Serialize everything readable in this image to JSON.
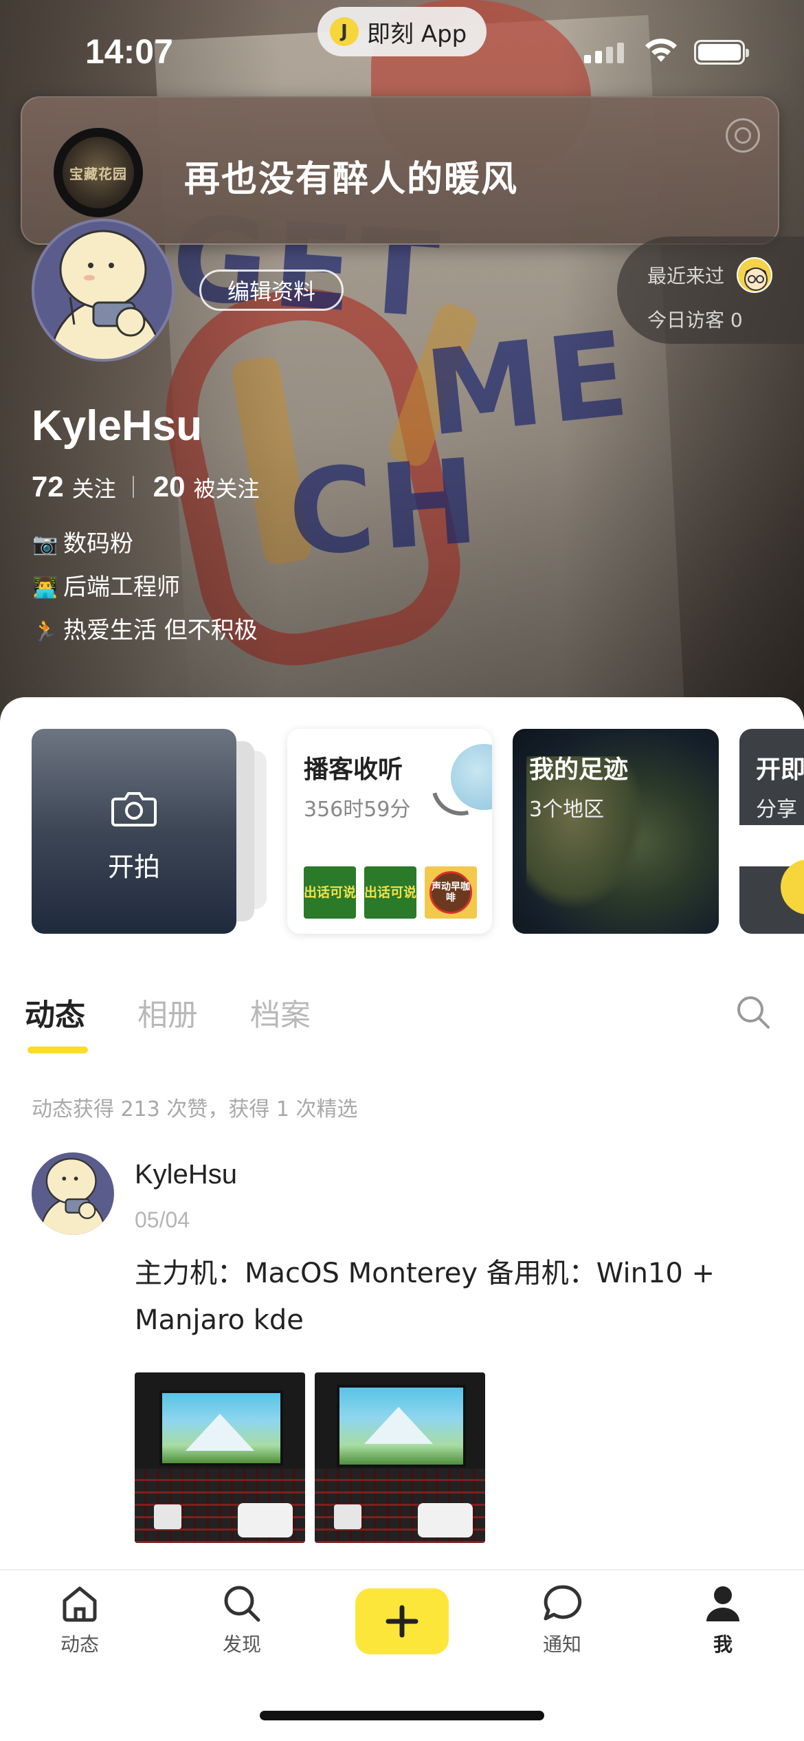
{
  "status_bar": {
    "time": "14:07",
    "app_pill_label": "即刻 App"
  },
  "now_playing": {
    "song_title": "再也没有醉人的暖风",
    "album_art_text": "宝藏花园"
  },
  "profile": {
    "edit_button_label": "编辑资料",
    "visitors": {
      "recent_label": "最近来过",
      "today_label": "今日访客 0"
    },
    "username": "KyleHsu",
    "following_count": "72",
    "following_label": "关注",
    "followers_count": "20",
    "followers_label": "被关注",
    "bio": [
      {
        "emoji": "📷",
        "text": "数码粉"
      },
      {
        "emoji": "👨‍💻",
        "text": "后端工程师"
      },
      {
        "emoji": "🏃",
        "text": "热爱生活 但不积极"
      }
    ]
  },
  "cards": {
    "camera": {
      "label": "开拍"
    },
    "podcast": {
      "title": "播客收听",
      "subtitle": "356时59分",
      "covers": [
        "出话可说",
        "出话可说",
        "声动早咖啡"
      ]
    },
    "footprint": {
      "title": "我的足迹",
      "subtitle": "3个地区"
    },
    "partial": {
      "title": "开即",
      "subtitle": "分享"
    }
  },
  "tabs": [
    {
      "label": "动态",
      "active": true
    },
    {
      "label": "相册",
      "active": false
    },
    {
      "label": "档案",
      "active": false
    }
  ],
  "stats_text": "动态获得 213 次赞，获得 1 次精选",
  "post": {
    "author": "KyleHsu",
    "date": "05/04",
    "text": "主力机：MacOS Monterey 备用机：Win10 + Manjaro kde",
    "photo_count": 2
  },
  "bottom_nav": [
    {
      "label": "动态",
      "icon": "home-icon",
      "active": false
    },
    {
      "label": "发现",
      "icon": "search-icon",
      "active": false
    },
    {
      "label": "",
      "icon": "plus-icon",
      "active": false
    },
    {
      "label": "通知",
      "icon": "chat-bubble-icon",
      "active": false
    },
    {
      "label": "我",
      "icon": "person-icon",
      "active": true
    }
  ],
  "colors": {
    "accent_yellow": "#fde63a",
    "tab_underline": "#fbdb2b",
    "text_primary": "#222222",
    "text_muted": "#a8a8a8"
  }
}
